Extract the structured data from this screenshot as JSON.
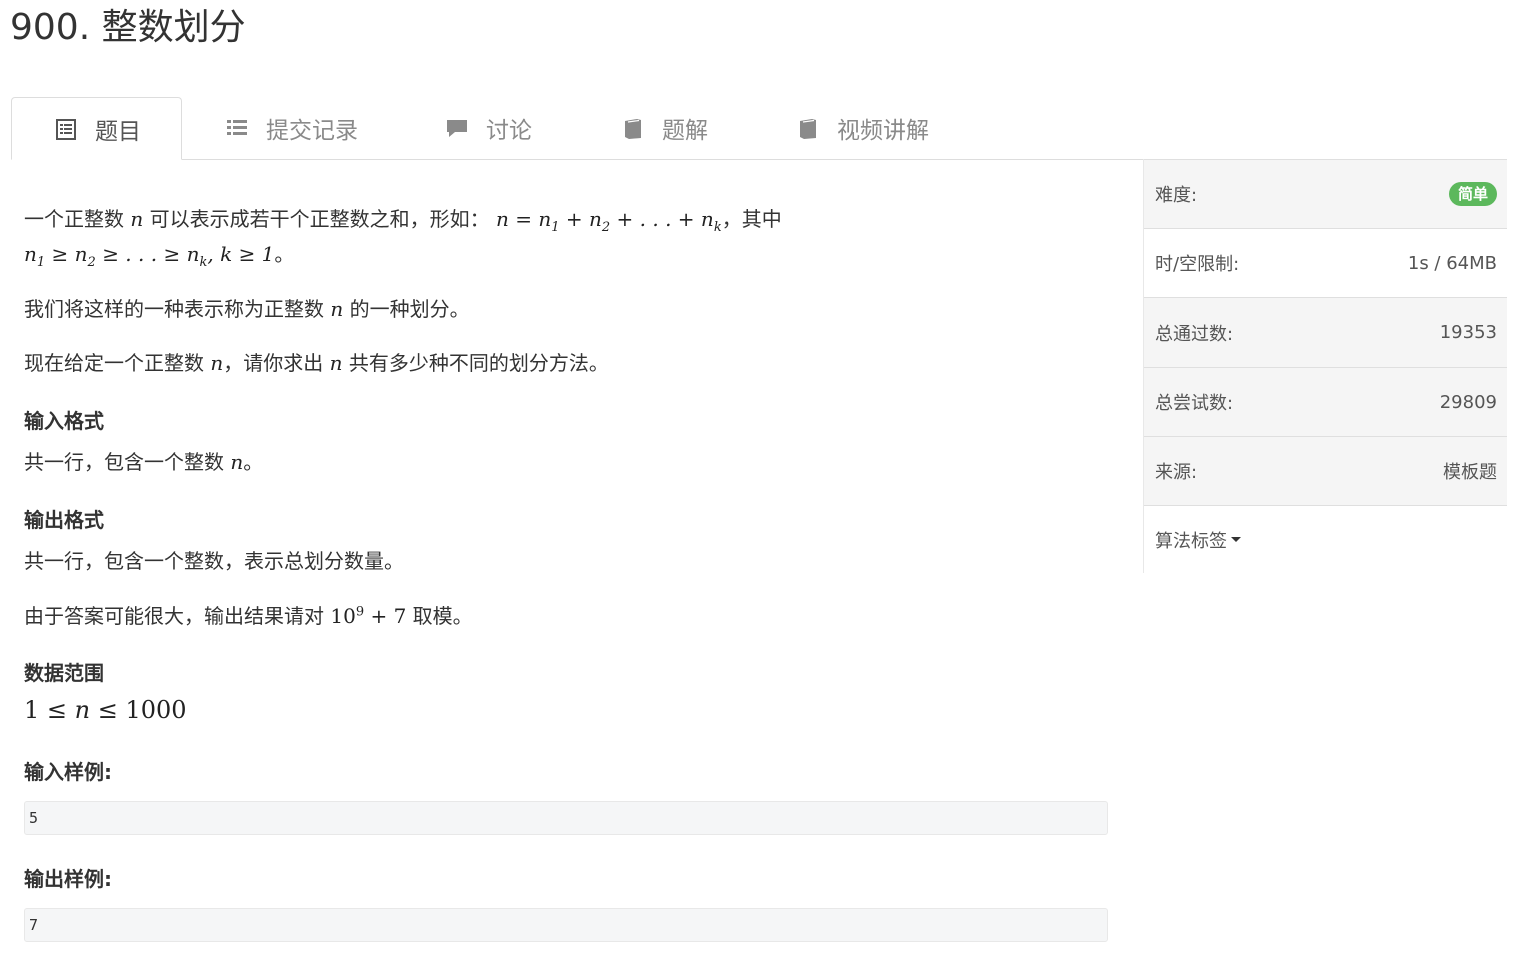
{
  "page": {
    "title": "900. 整数划分"
  },
  "tabs": [
    {
      "label": "题目",
      "icon": "document-icon",
      "active": true
    },
    {
      "label": "提交记录",
      "icon": "list-icon"
    },
    {
      "label": "讨论",
      "icon": "comment-icon"
    },
    {
      "label": "题解",
      "icon": "book-icon"
    },
    {
      "label": "视频讲解",
      "icon": "book-icon"
    }
  ],
  "problem": {
    "intro1": "一个正整数",
    "intro2": "可以表示成若干个正整数之和，形如：",
    "intro3": "，其中",
    "intro4": "。",
    "def1": "我们将这样的一种表示称为正整数",
    "def2": "的一种划分。",
    "task1": "现在给定一个正整数",
    "task2": "，请你求出",
    "task3": "共有多少种不同的划分方法。",
    "input_heading": "输入格式",
    "input_text1": "共一行，包含一个整数",
    "input_text2": "。",
    "output_heading": "输出格式",
    "output_text": "共一行，包含一个整数，表示总划分数量。",
    "mod1": "由于答案可能很大，输出结果请对",
    "mod2": "取模。",
    "range_heading": "数据范围",
    "sample_in_heading": "输入样例:",
    "sample_in": "5",
    "sample_out_heading": "输出样例:",
    "sample_out": "7"
  },
  "side": {
    "difficulty_label": "难度:",
    "difficulty_value": "简单",
    "limit_label": "时/空限制:",
    "limit_value": "1s / 64MB",
    "passed_label": "总通过数:",
    "passed_value": "19353",
    "attempts_label": "总尝试数:",
    "attempts_value": "29809",
    "source_label": "来源:",
    "source_value": "模板题",
    "tags_label": "算法标签"
  },
  "colors": {
    "difficulty_badge": "#5cb85c",
    "tab_border": "#dddddd"
  }
}
